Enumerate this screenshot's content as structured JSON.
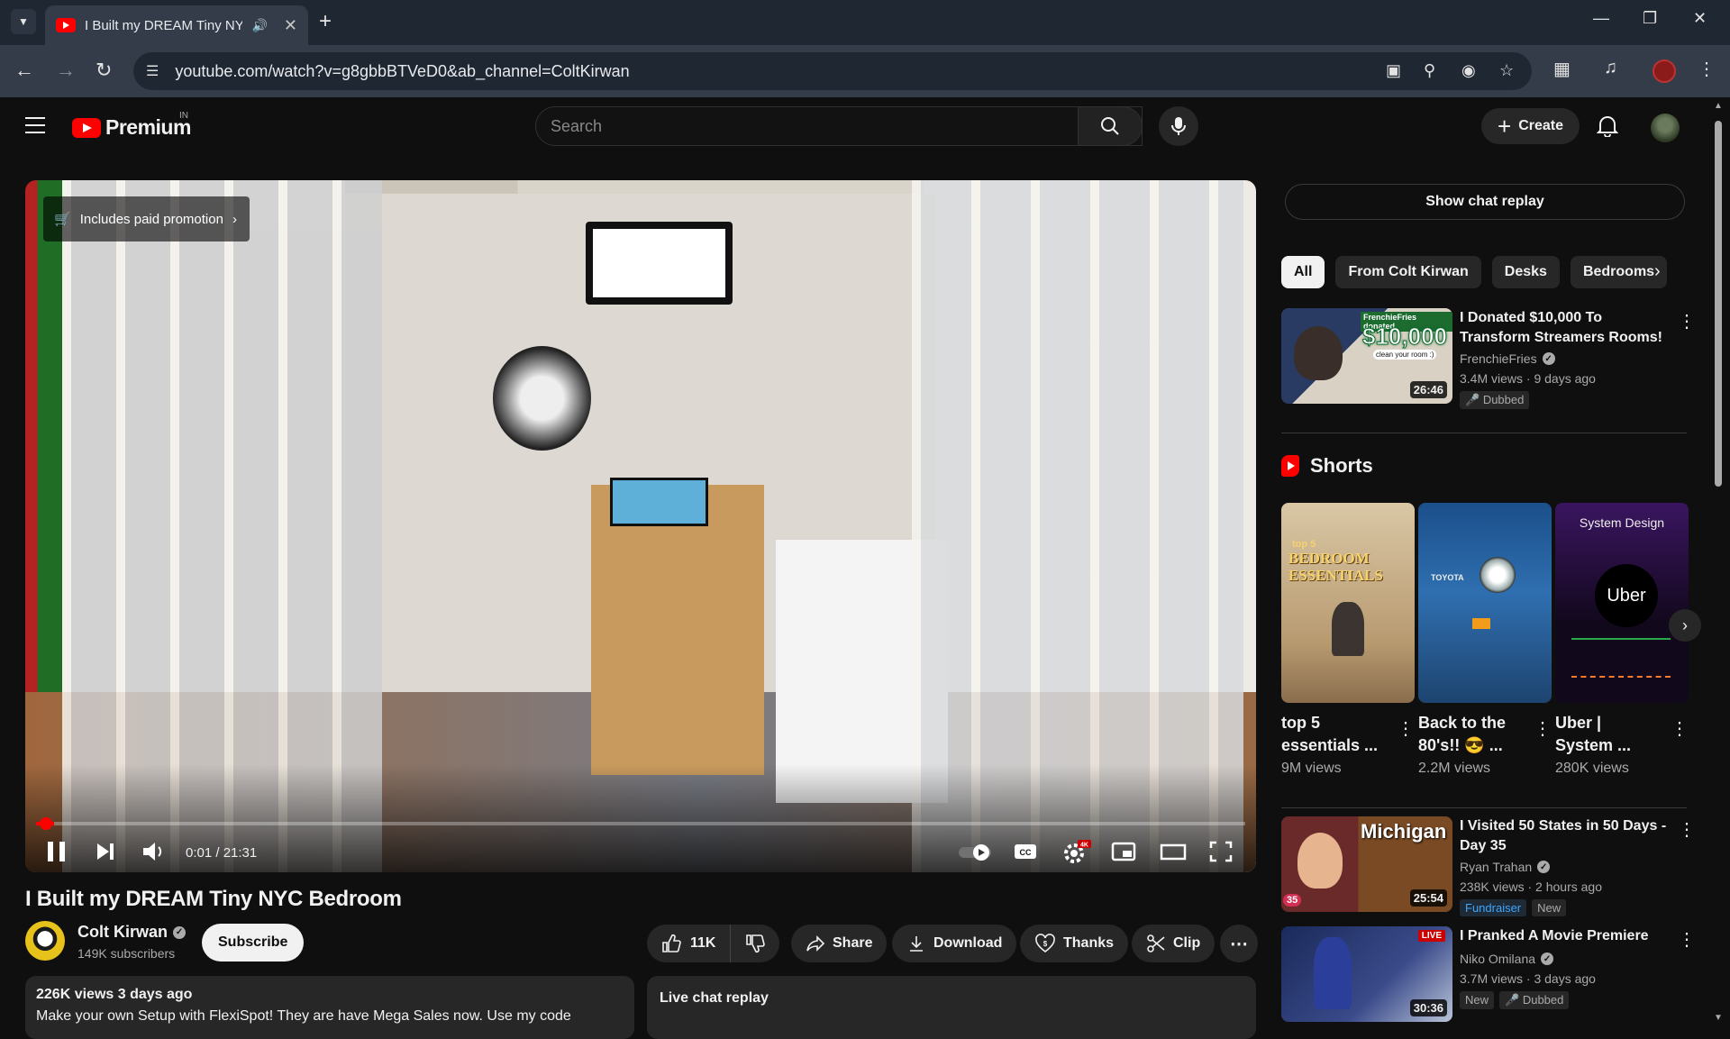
{
  "browser": {
    "tab_title": "I Built my DREAM Tiny NYC",
    "url": "youtube.com/watch?v=g8gbbBTVeD0&ab_channel=ColtKirwan"
  },
  "header": {
    "logo_text": "Premium",
    "logo_country": "IN",
    "search_placeholder": "Search",
    "create_label": "Create"
  },
  "player": {
    "promotion": "Includes paid promotion",
    "time": "0:01 / 21:31",
    "progress": 0.0008,
    "settings_badge": "4K"
  },
  "video": {
    "title": "I Built my DREAM Tiny NYC Bedroom",
    "channel": "Colt Kirwan",
    "subscribers": "149K subscribers",
    "subscribe_label": "Subscribe",
    "likes": "11K",
    "share_label": "Share",
    "download_label": "Download",
    "thanks_label": "Thanks",
    "clip_label": "Clip",
    "views_date": "226K views  3 days ago",
    "description": "Make your own Setup with FlexiSpot! They are have Mega Sales now. Use my code",
    "live_chat_replay": "Live chat replay"
  },
  "sidebar": {
    "show_chat_replay": "Show chat replay",
    "chips": [
      "All",
      "From Colt Kirwan",
      "Desks",
      "Bedrooms"
    ],
    "recommendations": [
      {
        "title": "I Donated $10,000 To Transform Streamers Rooms!",
        "channel": "FrenchieFries",
        "meta": "3.4M views · 9 days ago",
        "badges": [
          "Dubbed"
        ],
        "duration": "26:46",
        "thumb_text": "$10,000",
        "thumb_small": "FrenchieFries donated",
        "thumb_small2": "clean your room :)"
      },
      {
        "title": "I Visited 50 States in 50 Days - Day 35",
        "channel": "Ryan Trahan",
        "meta": "238K views · 2 hours ago",
        "badges": [
          "Fundraiser",
          "New"
        ],
        "duration": "25:54",
        "thumb_text": "Michigan",
        "thumb_small": "35"
      },
      {
        "title": "I Pranked A Movie Premiere",
        "channel": "Niko Omilana",
        "meta": "3.7M views · 3 days ago",
        "badges": [
          "New",
          "Dubbed"
        ],
        "duration": "30:36",
        "thumb_small": "LIVE"
      }
    ],
    "shorts_title": "Shorts",
    "shorts": [
      {
        "title": "top 5 essentials ...",
        "views": "9M views",
        "thumb_text": "BEDROOM ESSENTIALS",
        "thumb_small": "top 5"
      },
      {
        "title": "Back to the 80's!! 😎 ...",
        "views": "2.2M views",
        "thumb_small": "TOYOTA"
      },
      {
        "title": "Uber | System ...",
        "views": "280K views",
        "thumb_text": "Uber",
        "thumb_small": "System Design"
      }
    ]
  }
}
